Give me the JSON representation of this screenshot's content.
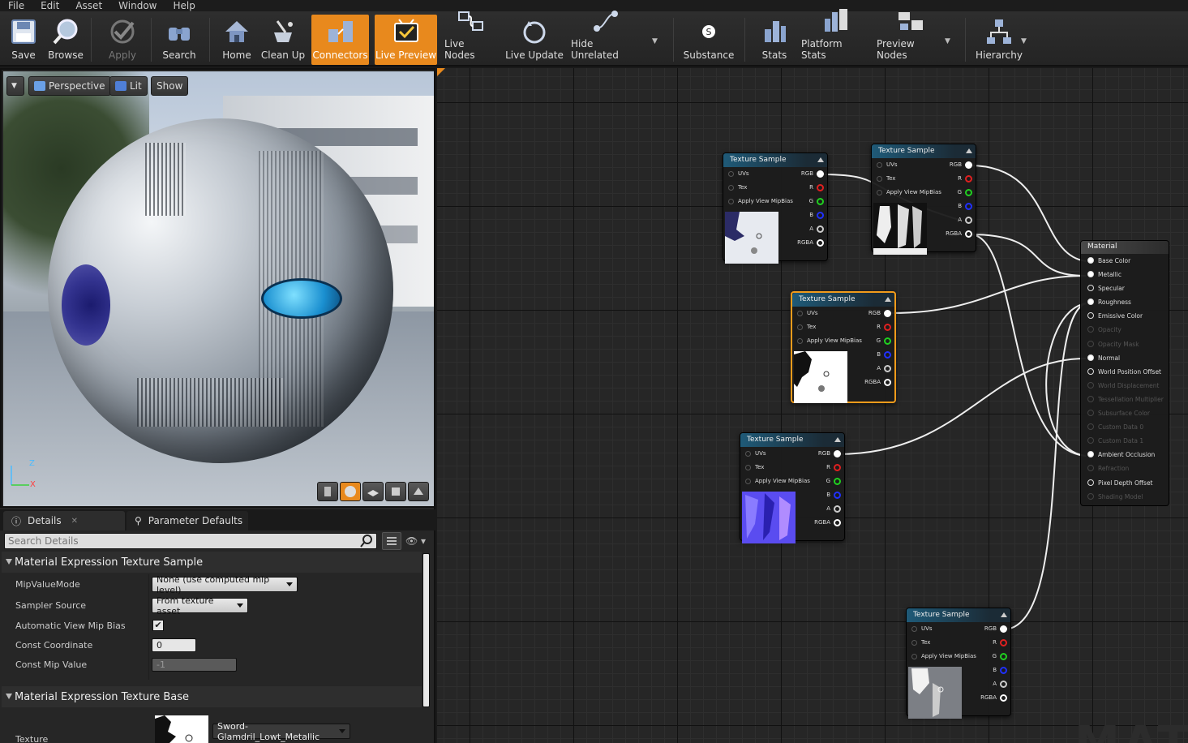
{
  "menu": [
    "File",
    "Edit",
    "Asset",
    "Window",
    "Help"
  ],
  "toolbar": {
    "buttons": [
      {
        "label": "Save",
        "icon": "save-icon"
      },
      {
        "label": "Browse",
        "icon": "browse-icon"
      },
      {
        "label": "Apply",
        "icon": "apply-icon",
        "disabled": true
      },
      {
        "label": "Search",
        "icon": "search-icon"
      },
      {
        "label": "Home",
        "icon": "home-icon"
      },
      {
        "label": "Clean Up",
        "icon": "clean-up-icon"
      },
      {
        "label": "Connectors",
        "icon": "connectors-icon",
        "active": true
      },
      {
        "label": "Live Preview",
        "icon": "live-preview-icon",
        "active": true
      },
      {
        "label": "Live Nodes",
        "icon": "live-nodes-icon"
      },
      {
        "label": "Live Update",
        "icon": "live-update-icon"
      },
      {
        "label": "Hide Unrelated",
        "icon": "hide-unrelated-icon"
      },
      {
        "label": "Substance",
        "icon": "substance-icon"
      },
      {
        "label": "Stats",
        "icon": "stats-icon"
      },
      {
        "label": "Platform Stats",
        "icon": "platform-stats-icon"
      },
      {
        "label": "Preview Nodes",
        "icon": "preview-nodes-icon"
      },
      {
        "label": "Hierarchy",
        "icon": "hierarchy-icon"
      }
    ],
    "accent_color": "#e8891d"
  },
  "viewport": {
    "perspective_label": "Perspective",
    "lit_label": "Lit",
    "show_label": "Show",
    "axis_z": "Z",
    "axis_x": "X"
  },
  "details": {
    "tab_details": "Details",
    "tab_params": "Parameter Defaults",
    "search_placeholder": "Search Details",
    "section1": "Material Expression Texture Sample",
    "section2": "Material Expression Texture Base",
    "props": {
      "mip_value_mode_label": "MipValueMode",
      "mip_value_mode_value": "None (use computed mip level)",
      "sampler_source_label": "Sampler Source",
      "sampler_source_value": "From texture asset",
      "auto_view_mip_bias_label": "Automatic View Mip Bias",
      "auto_view_mip_bias_checked": "✔",
      "const_coordinate_label": "Const Coordinate",
      "const_coordinate_value": "0",
      "const_mip_value_label": "Const Mip Value",
      "const_mip_value_value": "-1",
      "texture_label": "Texture",
      "texture_value": "Sword-Glamdril_Lowt_Metallic"
    }
  },
  "graph": {
    "node_title": "Texture Sample",
    "pins_in": [
      "UVs",
      "Tex",
      "Apply View MipBias"
    ],
    "pins_out": [
      "RGB",
      "R",
      "G",
      "B",
      "A",
      "RGBA"
    ],
    "pin_colors": {
      "RGB": "#ffffff",
      "R": "#e02020",
      "G": "#20d020",
      "B": "#2030ff",
      "A": "#cccccc",
      "RGBA": "#ffffff"
    },
    "material_title": "Material",
    "material_pins": [
      {
        "label": "Base Color",
        "active": true
      },
      {
        "label": "Metallic",
        "active": true
      },
      {
        "label": "Specular",
        "active": true
      },
      {
        "label": "Roughness",
        "active": true
      },
      {
        "label": "Emissive Color",
        "active": true
      },
      {
        "label": "Opacity",
        "active": false
      },
      {
        "label": "Opacity Mask",
        "active": false
      },
      {
        "label": "Normal",
        "active": true
      },
      {
        "label": "World Position Offset",
        "active": true
      },
      {
        "label": "World Displacement",
        "active": false
      },
      {
        "label": "Tessellation Multiplier",
        "active": false
      },
      {
        "label": "Subsurface Color",
        "active": false
      },
      {
        "label": "Custom Data 0",
        "active": false
      },
      {
        "label": "Custom Data 1",
        "active": false
      },
      {
        "label": "Ambient Occlusion",
        "active": true
      },
      {
        "label": "Refraction",
        "active": false
      },
      {
        "label": "Pixel Depth Offset",
        "active": true
      },
      {
        "label": "Shading Model",
        "active": false
      }
    ],
    "watermark": "MATE"
  }
}
